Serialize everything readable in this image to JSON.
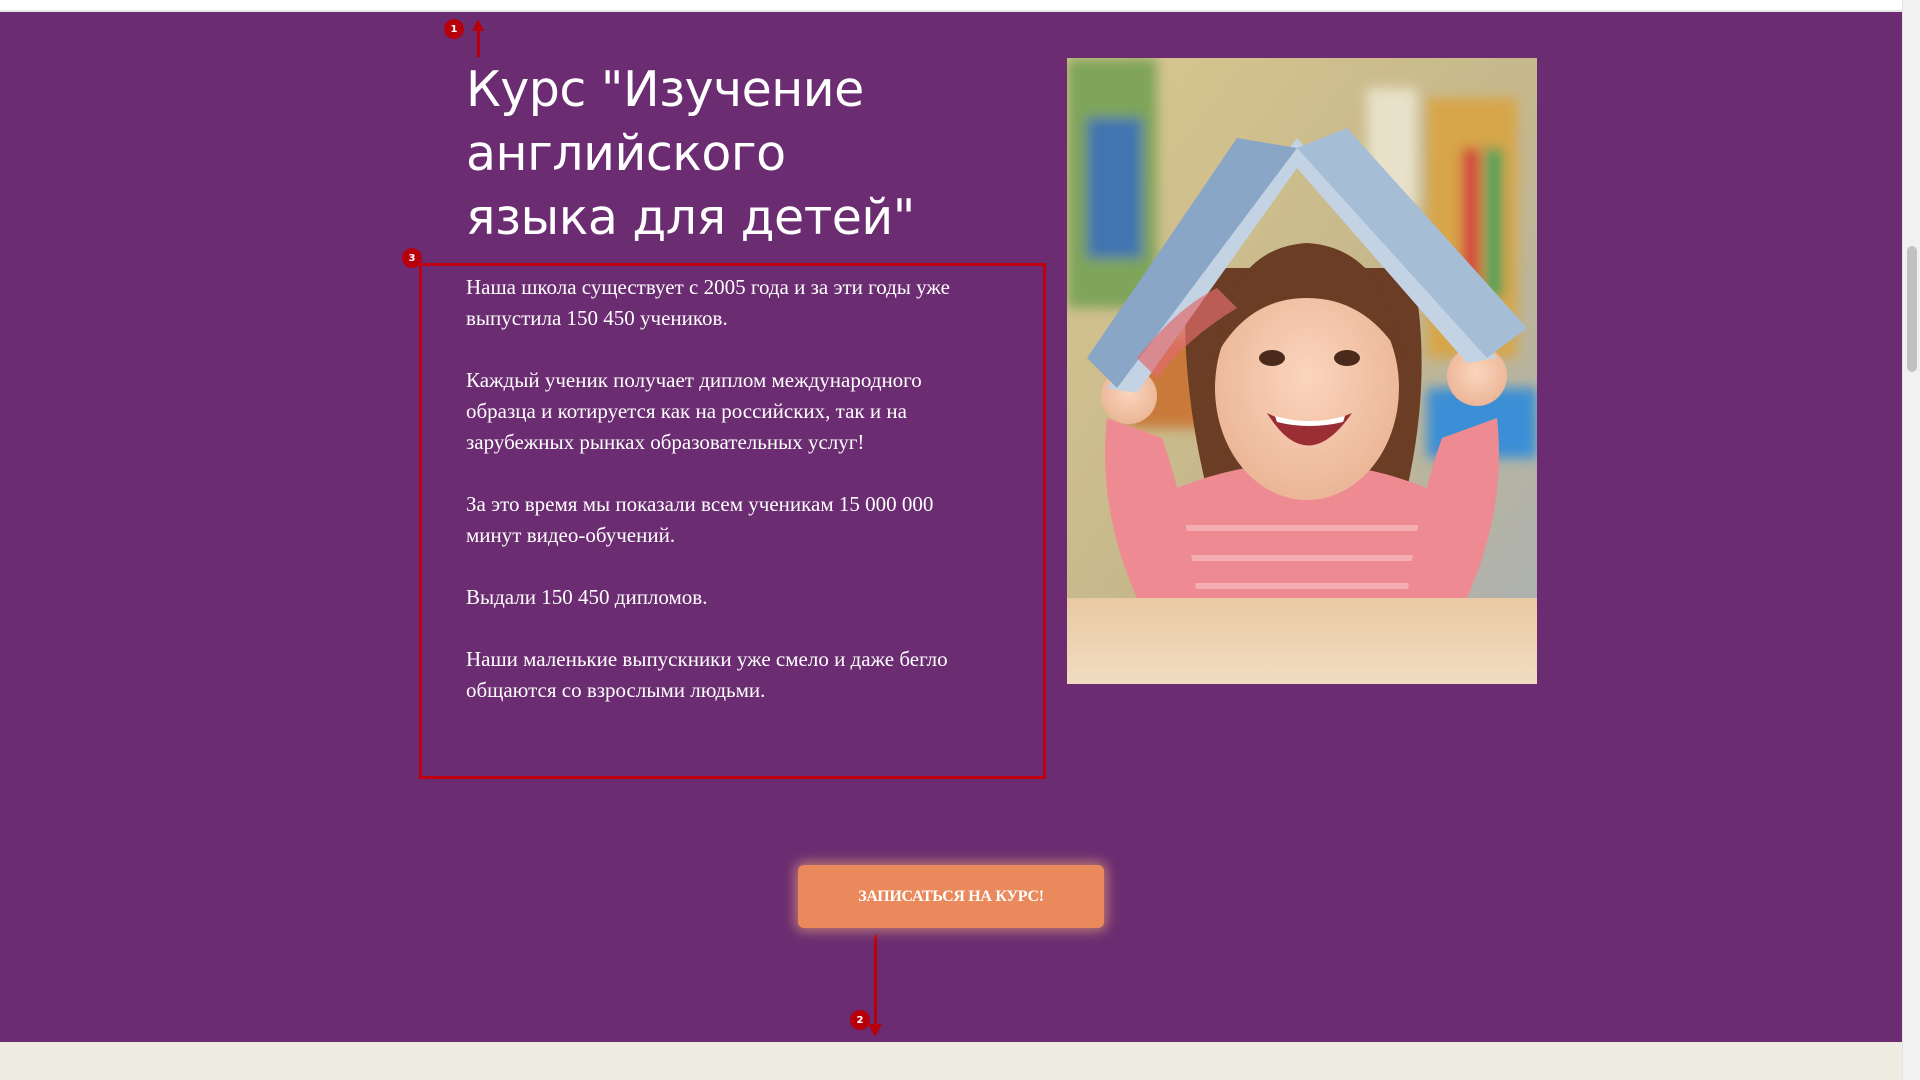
{
  "hero": {
    "title_lines": [
      "Курс \"Изучение",
      "английского",
      "языка для детей\""
    ],
    "paragraphs": [
      "Наша школа существует с 2005 года и за эти годы уже выпустила 150 450 учеников.",
      "Каждый ученик получает диплом международного образца и котируется как на российских, так и на зарубежных рынках образовательных услуг!",
      "За это время мы показали всем ученикам 15 000 000 минут видео-обучений.",
      "Выдали 150 450 дипломов.",
      "Наши маленькие выпускники уже смело и даже бегло общаются со взрослыми людьми."
    ],
    "cta_label": "ЗАПИСАТЬСЯ НА КУРС!",
    "photo_icon": "child-with-book-image"
  },
  "annotations": {
    "badges": [
      "1",
      "2",
      "3"
    ]
  },
  "colors": {
    "background": "#6b2c71",
    "accent": "#ea8a5c",
    "annotation": "#b8000c",
    "lower_band": "#efede2"
  }
}
